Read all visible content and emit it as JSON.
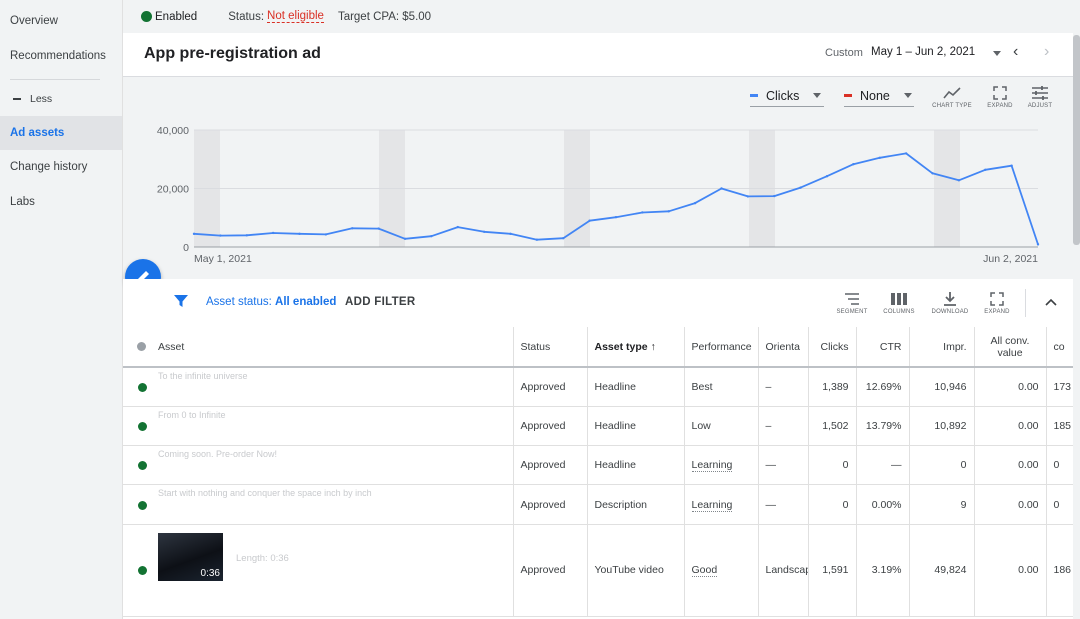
{
  "sidebar": {
    "items": [
      {
        "label": "Overview"
      },
      {
        "label": "Recommendations"
      },
      {
        "label": "Less"
      },
      {
        "label": "Ad assets"
      },
      {
        "label": "Change history"
      },
      {
        "label": "Labs"
      }
    ]
  },
  "topbar": {
    "enabled": "Enabled",
    "status_label": "Status:",
    "status_value": "Not eligible",
    "target_cpa": "Target CPA: $5.00"
  },
  "header": {
    "title": "App pre-registration ad",
    "date_preset": "Custom",
    "date_range": "May 1 – Jun 2, 2021"
  },
  "chart_toolbar": {
    "metric1": "Clicks",
    "metric2": "None",
    "tools": [
      "CHART TYPE",
      "EXPAND",
      "ADJUST"
    ]
  },
  "chart_data": {
    "type": "line",
    "series": [
      {
        "name": "Clicks",
        "values": [
          4500,
          3900,
          4000,
          4800,
          4500,
          4300,
          6400,
          6300,
          2800,
          3700,
          6800,
          5200,
          4500,
          2500,
          3000,
          9000,
          10200,
          11800,
          12200,
          15000,
          20000,
          17300,
          17400,
          20300,
          24200,
          28300,
          30500,
          32000,
          25200,
          22800,
          26400,
          27800,
          900
        ]
      }
    ],
    "x_labels": [
      "May 1, 2021",
      "Jun 2, 2021"
    ],
    "y_ticks": [
      "0",
      "20,000",
      "40,000"
    ],
    "ylim": [
      0,
      40000
    ],
    "colors": {
      "clicks": "#4285f4",
      "none": "#d93025"
    }
  },
  "filter": {
    "status_label": "Asset status:",
    "status_value": "All enabled",
    "add_filter": "ADD FILTER",
    "tools": [
      "SEGMENT",
      "COLUMNS",
      "DOWNLOAD",
      "EXPAND"
    ]
  },
  "table": {
    "headers": {
      "asset": "Asset",
      "status": "Status",
      "asset_type": "Asset type",
      "performance": "Performance",
      "orientation": "Orienta",
      "clicks": "Clicks",
      "ctr": "CTR",
      "impr": "Impr.",
      "all_conv": "All conv. value",
      "extra": "co"
    },
    "rows": [
      {
        "asset": "To the infinite universe",
        "status": "Approved",
        "type": "Headline",
        "performance": "Best",
        "orientation": "–",
        "clicks": "1,389",
        "ctr": "12.69%",
        "impr": "10,946",
        "conv": "0.00",
        "extra": "173"
      },
      {
        "asset": "From 0 to Infinite",
        "status": "Approved",
        "type": "Headline",
        "performance": "Low",
        "orientation": "–",
        "clicks": "1,502",
        "ctr": "13.79%",
        "impr": "10,892",
        "conv": "0.00",
        "extra": "185"
      },
      {
        "asset": "Coming soon. Pre-order Now!",
        "status": "Approved",
        "type": "Headline",
        "performance": "Learning",
        "orientation": "—",
        "clicks": "0",
        "ctr": "—",
        "impr": "0",
        "conv": "0.00",
        "extra": "0"
      },
      {
        "asset": "Start with nothing and conquer the space inch by inch",
        "status": "Approved",
        "type": "Description",
        "performance": "Learning",
        "orientation": "—",
        "clicks": "0",
        "ctr": "0.00%",
        "impr": "9",
        "conv": "0.00",
        "extra": "0"
      },
      {
        "asset": "Length: 0:36",
        "duration": "0:36",
        "status": "Approved",
        "type": "YouTube video",
        "performance": "Good",
        "orientation": "Landscape",
        "clicks": "1,591",
        "ctr": "3.19%",
        "impr": "49,824",
        "conv": "0.00",
        "extra": "186"
      }
    ]
  }
}
